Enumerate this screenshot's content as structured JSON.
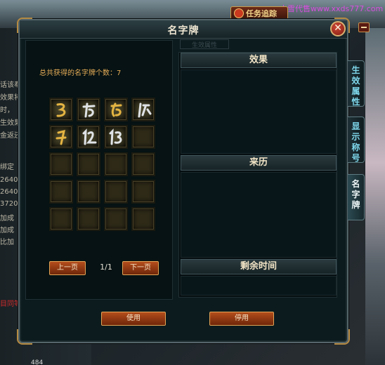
{
  "window": {
    "title": "名字牌"
  },
  "watermark": "小雪代售www.xxds777.com",
  "task_track": {
    "label": "任务追踪"
  },
  "left": {
    "count_label": "总共获得的名字牌个数：7",
    "count": 7,
    "slots": [
      {
        "filled": true,
        "tone": "gold",
        "glyph": "3"
      },
      {
        "filled": true,
        "tone": "silver",
        "glyph": "6"
      },
      {
        "filled": true,
        "tone": "gold",
        "glyph": "6"
      },
      {
        "filled": true,
        "tone": "silver",
        "glyph": "9"
      },
      {
        "filled": true,
        "tone": "gold",
        "glyph": "1"
      },
      {
        "filled": true,
        "tone": "silver",
        "glyph": "12"
      },
      {
        "filled": true,
        "tone": "silver",
        "glyph": "13"
      },
      {
        "filled": false
      },
      {
        "filled": false
      },
      {
        "filled": false
      },
      {
        "filled": false
      },
      {
        "filled": false
      },
      {
        "filled": false
      },
      {
        "filled": false
      },
      {
        "filled": false
      },
      {
        "filled": false
      },
      {
        "filled": false
      },
      {
        "filled": false
      },
      {
        "filled": false
      },
      {
        "filled": false
      }
    ],
    "prev_label": "上一页",
    "next_label": "下一页",
    "page_indicator": "1/1"
  },
  "right": {
    "effect_title": "效果",
    "source_title": "来历",
    "remaining_title": "剩余时间"
  },
  "actions": {
    "use_label": "使用",
    "disable_label": "停用"
  },
  "side_tabs": [
    {
      "label": "生效属性",
      "active": false
    },
    {
      "label": "显示称号",
      "active": false
    },
    {
      "label": "名字牌",
      "active": true
    }
  ],
  "background": {
    "left_lines": [
      "话该奉",
      "效果将",
      "时，",
      "生效果",
      "金返还",
      "绑定",
      "2640",
      "2640",
      "3720",
      "加成",
      "加成",
      "比加"
    ],
    "red_line": "目同等",
    "ghost_tab": "生效属性",
    "bottom_value": "484"
  }
}
